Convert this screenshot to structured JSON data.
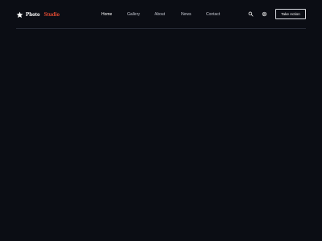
{
  "brand": {
    "icon": "star-icon",
    "name_part1": "Photo",
    "name_part2": "Studio",
    "accent_color": "#e04a32"
  },
  "nav": {
    "items": [
      {
        "label": "Home",
        "active": true
      },
      {
        "label": "Gallery",
        "active": false
      },
      {
        "label": "About",
        "active": false
      },
      {
        "label": "News",
        "active": false
      },
      {
        "label": "Contact",
        "active": false
      }
    ]
  },
  "actions": {
    "search_icon": "search-icon",
    "settings_icon": "settings-icon",
    "cta_label": "Take Action"
  },
  "theme": {
    "background": "#0b0d14",
    "text": "#ffffff",
    "muted_text": "#c3c6cf"
  }
}
